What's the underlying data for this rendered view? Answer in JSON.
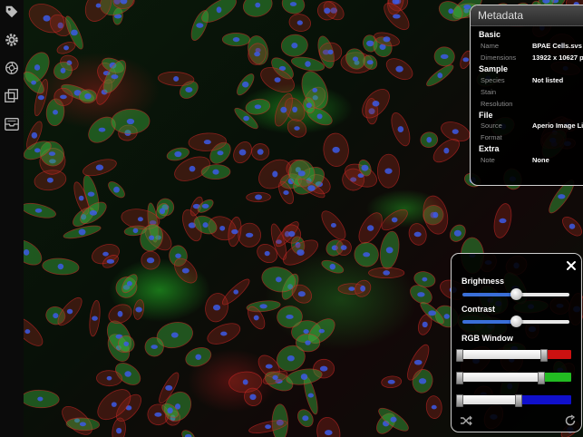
{
  "toolbar": {
    "icons": [
      "tag-icon",
      "gear-icon",
      "aperture-icon",
      "layers-icon",
      "tray-icon"
    ]
  },
  "metadata": {
    "title": "Metadata",
    "sections": {
      "basic": {
        "title": "Basic",
        "name_label": "Name",
        "name_value": "BPAE Cells.svs",
        "dimensions_label": "Dimensions",
        "dimensions_value": "13922 x 10627 p"
      },
      "sample": {
        "title": "Sample",
        "species_label": "Species",
        "species_value": "Not listed",
        "stain_label": "Stain",
        "resolution_label": "Resolution"
      },
      "file": {
        "title": "File",
        "source_label": "Source",
        "source_value": "Aperio Image Li",
        "format_label": "Format"
      },
      "extra": {
        "title": "Extra",
        "note_label": "Note",
        "note_value": "None"
      }
    }
  },
  "adjust": {
    "brightness_label": "Brightness",
    "brightness_level": 0.5,
    "contrast_label": "Contrast",
    "contrast_level": 0.5,
    "rgb_label": "RGB Window",
    "rgb_red_level": 0.75,
    "rgb_green_level": 0.73,
    "rgb_blue_level": 0.53,
    "colors": {
      "red": "#cc1111",
      "green": "#22bb22",
      "blue": "#1010cc",
      "slider_fill": "#3a6fd8"
    }
  }
}
